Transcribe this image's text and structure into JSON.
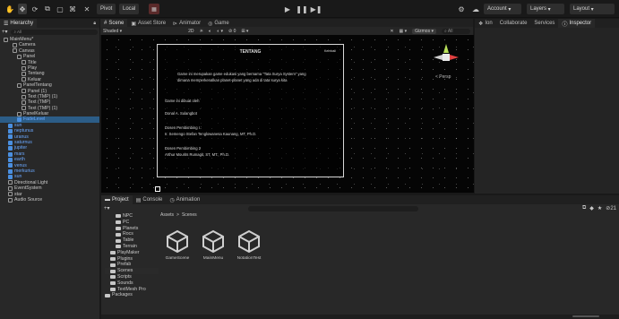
{
  "toolbar": {
    "pivot": "Pivot",
    "local": "Local",
    "account": "Account",
    "layers": "Layers",
    "layout": "Layout"
  },
  "hierarchy": {
    "title": "Hierarchy",
    "search_placeholder": "All",
    "items": [
      {
        "label": "MainMenu*",
        "indent": 0,
        "icon": "unity-logo-icon",
        "blue": false
      },
      {
        "label": "Camera",
        "indent": 2,
        "icon": "gameobject-icon",
        "blue": false
      },
      {
        "label": "Canvas",
        "indent": 2,
        "icon": "gameobject-icon",
        "blue": false
      },
      {
        "label": "Panel",
        "indent": 3,
        "icon": "gameobject-icon",
        "blue": false
      },
      {
        "label": "Title",
        "indent": 4,
        "icon": "gameobject-icon",
        "blue": false
      },
      {
        "label": "Play",
        "indent": 4,
        "icon": "gameobject-icon",
        "blue": false
      },
      {
        "label": "Tentang",
        "indent": 4,
        "icon": "gameobject-icon",
        "blue": false
      },
      {
        "label": "Keluar",
        "indent": 4,
        "icon": "gameobject-icon",
        "blue": false
      },
      {
        "label": "PanelTentang",
        "indent": 3,
        "icon": "gameobject-icon",
        "blue": false
      },
      {
        "label": "Panel (1)",
        "indent": 4,
        "icon": "gameobject-icon",
        "blue": false
      },
      {
        "label": "Text (TMP) (1)",
        "indent": 4,
        "icon": "gameobject-icon",
        "blue": false
      },
      {
        "label": "Text (TMP)",
        "indent": 4,
        "icon": "gameobject-icon",
        "blue": false
      },
      {
        "label": "Text (TMP) (1)",
        "indent": 4,
        "icon": "gameobject-icon",
        "blue": false
      },
      {
        "label": "PanelKeluar",
        "indent": 3,
        "icon": "gameobject-icon",
        "blue": false
      },
      {
        "label": "FadeLevel",
        "indent": 3,
        "icon": "prefab-icon",
        "blue": true
      },
      {
        "label": "sun",
        "indent": 1,
        "icon": "prefab-icon",
        "blue": true
      },
      {
        "label": "neptunus",
        "indent": 1,
        "icon": "prefab-icon",
        "blue": true
      },
      {
        "label": "uranus",
        "indent": 1,
        "icon": "prefab-icon",
        "blue": true
      },
      {
        "label": "saturnus",
        "indent": 1,
        "icon": "prefab-icon",
        "blue": true
      },
      {
        "label": "jupiter",
        "indent": 1,
        "icon": "prefab-icon",
        "blue": true
      },
      {
        "label": "mars",
        "indent": 1,
        "icon": "prefab-icon",
        "blue": true
      },
      {
        "label": "earth",
        "indent": 1,
        "icon": "prefab-icon",
        "blue": true
      },
      {
        "label": "venus",
        "indent": 1,
        "icon": "prefab-icon",
        "blue": true
      },
      {
        "label": "merkurius",
        "indent": 1,
        "icon": "prefab-icon",
        "blue": true
      },
      {
        "label": "sun",
        "indent": 1,
        "icon": "prefab-icon",
        "blue": true
      },
      {
        "label": "Directional Light",
        "indent": 1,
        "icon": "gameobject-icon",
        "blue": false
      },
      {
        "label": "EventSystem",
        "indent": 1,
        "icon": "gameobject-icon",
        "blue": false
      },
      {
        "label": "star",
        "indent": 1,
        "icon": "gameobject-icon",
        "blue": false
      },
      {
        "label": "Audio Source",
        "indent": 1,
        "icon": "gameobject-icon",
        "blue": false
      }
    ]
  },
  "scene_tabs": {
    "scene": "Scene",
    "asset_store": "Asset Store",
    "animator": "Animator",
    "game": "Game",
    "shaded": "Shaded",
    "mode_2d": "2D",
    "gizmos": "Gizmos",
    "gizmo_search": "All",
    "persp": "< Persp"
  },
  "menu_panel": {
    "title": "TENTANG",
    "close": "Kembali",
    "description_1": "Game ini merupakan game edukasi yang bernama \"Tata Surya System\" yang",
    "description_2": "dimana memperkenalkan planet-planet yang ada di tata surya kita",
    "creator_label": "Game ini dibuat oleh",
    "creator_name": "Donal A. Sulangbot",
    "advisor1_label": "Dosen Pembimbing I :",
    "advisor1_name": "Ir. Semengo Stefan Tenglowanesa Kaunang, MT, Ph.D.",
    "advisor2_label": "Dosen Pembimbing 2",
    "advisor2_name": "Arthur Mourits Rumagit, ST, MT., Ph.D."
  },
  "inspector_tabs": {
    "inspector": "Inspector",
    "collaborate": "Collaborate",
    "services": "Services",
    "ion": "Ion"
  },
  "project": {
    "tab_project": "Project",
    "tab_console": "Console",
    "tab_animation": "Animation",
    "breadcrumb_root": "Assets",
    "breadcrumb_sep": ">",
    "breadcrumb_current": "Scenes",
    "count": "21",
    "folders": [
      {
        "label": "NPC",
        "indent": 1
      },
      {
        "label": "PC",
        "indent": 1
      },
      {
        "label": "Planets",
        "indent": 1
      },
      {
        "label": "Rocs",
        "indent": 1
      },
      {
        "label": "Table",
        "indent": 1
      },
      {
        "label": "Terrain",
        "indent": 1
      },
      {
        "label": "PlayMaker",
        "indent": 0
      },
      {
        "label": "Plugins",
        "indent": 0
      },
      {
        "label": "Prefab",
        "indent": 0
      },
      {
        "label": "Scenes",
        "indent": 0
      },
      {
        "label": "Scripts",
        "indent": 0
      },
      {
        "label": "Sounds",
        "indent": 0
      },
      {
        "label": "TextMesh Pro",
        "indent": 0
      },
      {
        "label": "Packages",
        "indent": -1
      }
    ],
    "assets": [
      {
        "label": "GameScene"
      },
      {
        "label": "MainMenu"
      },
      {
        "label": "NotationTest"
      }
    ]
  },
  "colors": {
    "accent_blue": "#4a8fe0",
    "bg": "#191919",
    "panel": "#282828",
    "red": "#e04040",
    "yellow_green": "#b8e05a"
  }
}
